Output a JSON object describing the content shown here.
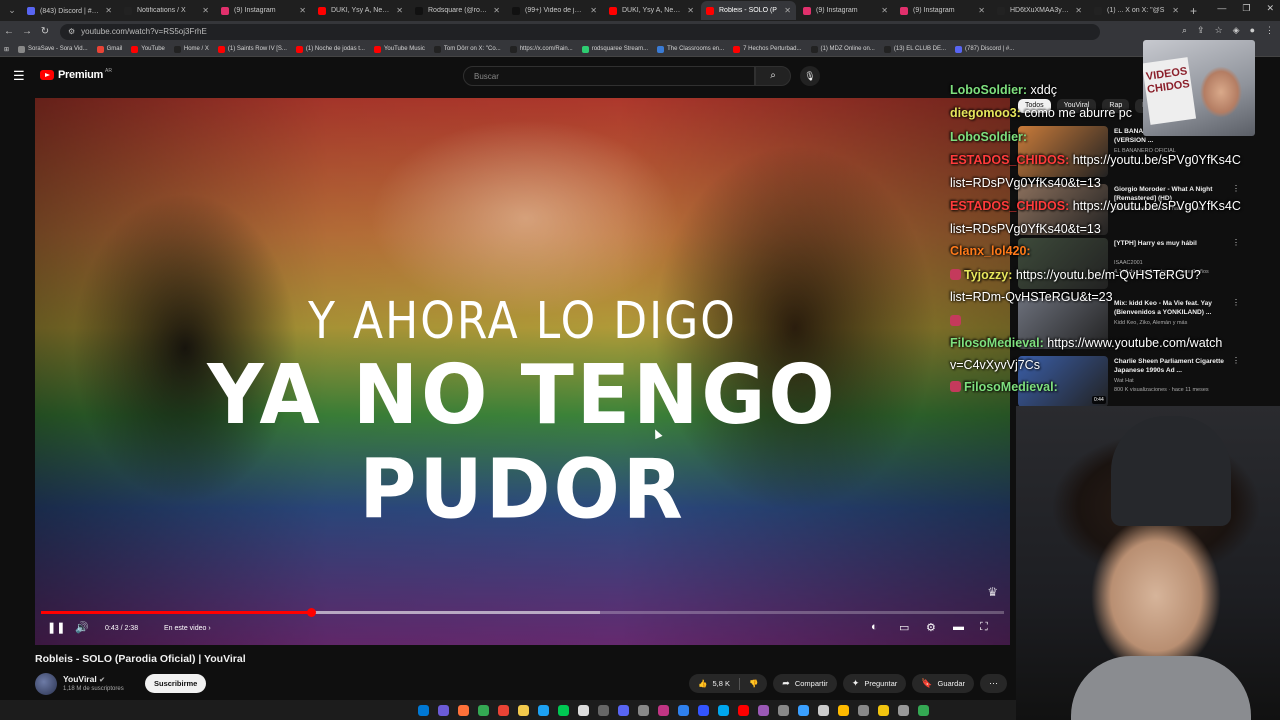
{
  "browser": {
    "tabs": [
      {
        "label": "(843) Discord | #🎯 ro",
        "color": "#5865f2"
      },
      {
        "label": "Notifications / X",
        "color": "#222222"
      },
      {
        "label": "(9) Instagram",
        "color": "#e1306c"
      },
      {
        "label": "DUKI, Ysy A, Neo Pist",
        "color": "#ff0000"
      },
      {
        "label": "Rodsquare (@rodsqu",
        "color": "#111111"
      },
      {
        "label": "(99+) Video de jonefe",
        "color": "#111111"
      },
      {
        "label": "DUKI, Ysy A, Neo Pist",
        "color": "#ff0000"
      },
      {
        "label": "Robleis - SOLO (P",
        "color": "#ff0000",
        "active": true
      },
      {
        "label": "(9) Instagram",
        "color": "#e1306c"
      },
      {
        "label": "(9) Instagram",
        "color": "#e1306c"
      },
      {
        "label": "HD6tXuXMAA3yqH",
        "color": "#222222"
      },
      {
        "label": "(1) ... X on X: \"@S",
        "color": "#222222"
      }
    ],
    "url": "youtube.com/watch?v=RS5oj3FrhE",
    "bookmarks": [
      {
        "label": "SoraSave - Sora Vid...",
        "color": "#888888"
      },
      {
        "label": "Gmail",
        "color": "#ea4335"
      },
      {
        "label": "YouTube",
        "color": "#ff0000"
      },
      {
        "label": "Home / X",
        "color": "#222222"
      },
      {
        "label": "(1) Saints Row IV [S...",
        "color": "#ff0000"
      },
      {
        "label": "(1) Noche de jodas t...",
        "color": "#ff0000"
      },
      {
        "label": "YouTube Music",
        "color": "#ff0000"
      },
      {
        "label": "Tom Dörr on X: \"Co...",
        "color": "#222222"
      },
      {
        "label": "https://x.com/Rain...",
        "color": "#222222"
      },
      {
        "label": "rodsquaree Stream...",
        "color": "#2ecc71"
      },
      {
        "label": "The Classrooms en...",
        "color": "#3a7bd5"
      },
      {
        "label": "7 Hechos Perturbad...",
        "color": "#ff0000"
      },
      {
        "label": "(1) MDZ Online on...",
        "color": "#222222"
      },
      {
        "label": "(13) EL CLUB DE...",
        "color": "#222222"
      },
      {
        "label": "(787) Discord | #...",
        "color": "#5865f2"
      }
    ]
  },
  "youtube": {
    "logo_text": "Premium",
    "country": "AR",
    "search_placeholder": "Buscar"
  },
  "player": {
    "lyric_line1": "Y AHORA LO DIGO",
    "lyric_line2": "YA NO TENGO PUDOR",
    "time": "0:43 / 2:38",
    "chapter": "En este video",
    "played_fraction": 0.28,
    "loaded_fraction": 0.58
  },
  "video": {
    "title": "Robleis - SOLO (Parodia Oficial) | YouViral",
    "channel": "YouViral",
    "subscribers": "1,18 M de suscriptores",
    "subscribe_label": "Suscribirme",
    "likes": "5,8 K",
    "share_label": "Compartir",
    "ask_label": "Preguntar",
    "save_label": "Guardar"
  },
  "filters": [
    "Todos",
    "YouViral",
    "Rap",
    "F"
  ],
  "recommendations": [
    {
      "title": "EL BANANERO - \"GANGNAM STYLE\" (VERSION ...",
      "channel": "EL BANANERO OFICIAL",
      "meta": "",
      "duration": "",
      "thumb": "#c97b3a"
    },
    {
      "title": "Giorgio Moroder - What A Night [Remastered] (HD)",
      "channel": "",
      "meta": "328 K visualizaciones · hace 12 años",
      "duration": "",
      "thumb": "#8a6f5c"
    },
    {
      "title": "[YTPH] Harry es muy hábil",
      "channel": "ISAAC2001",
      "meta": "4,1 M de visualizaciones · hace 7 años",
      "duration": "",
      "thumb": "#3d4a3a"
    },
    {
      "title": "Mix: kidd Keo - Ma Vie feat. Yay (Bienvenidos a YONKILAND) ...",
      "channel": "Kidd Keo, Ziko, Alemán y más",
      "meta": "",
      "duration": "",
      "thumb": "#6b6f7a"
    },
    {
      "title": "Charlie Sheen Parliament Cigarette Japanese 1990s Ad ...",
      "channel": "Wat Hat",
      "meta": "800 K visualizaciones · hace 11 meses",
      "duration": "0:44",
      "thumb": "#3a5ea8"
    }
  ],
  "chat": [
    {
      "user": "LoboSoldier:",
      "text": " xddç",
      "color": "#7ee07e",
      "badge": false
    },
    {
      "user": "diegomoo3:",
      "text": " como me aburre pc",
      "color": "#e6e65c",
      "badge": false
    },
    {
      "user": "LoboSoldier:",
      "text": "",
      "color": "#7ee07e",
      "badge": false
    },
    {
      "user": "ESTADOS_CHIDOS:",
      "text": " https://youtu.be/sPVg0YfKs4C",
      "color": "#ff3b3b",
      "badge": false
    },
    {
      "user": "",
      "text": "list=RDsPVg0YfKs40&t=13",
      "color": "#ffffff",
      "badge": false
    },
    {
      "user": "ESTADOS_CHIDOS:",
      "text": " https://youtu.be/sPVg0YfKs4C",
      "color": "#ff3b3b",
      "badge": false
    },
    {
      "user": "",
      "text": "list=RDsPVg0YfKs40&t=13",
      "color": "#ffffff",
      "badge": false
    },
    {
      "user": "Clanx_lol420:",
      "text": "",
      "color": "#ff7a1a",
      "badge": false
    },
    {
      "user": "Tyjozzy:",
      "text": " https://youtu.be/m-QvHSTeRGU?",
      "color": "#e6e65c",
      "badge": true
    },
    {
      "user": "",
      "text": "list=RDm-QvHSTeRGU&t=23",
      "color": "#ffffff",
      "badge": false
    },
    {
      "user": "",
      "text": "",
      "color": "#ffffff",
      "badge": true
    },
    {
      "user": "FilosoMedieval:",
      "text": " https://www.youtube.com/watch",
      "color": "#7ee07e",
      "badge": false
    },
    {
      "user": "",
      "text": "v=C4vXyvVj7Cs",
      "color": "#ffffff",
      "badge": false
    },
    {
      "user": "FilosoMedieval:",
      "text": "",
      "color": "#7ee07e",
      "badge": true
    }
  ],
  "pip_sign": "VIDEOS CHIDOS",
  "taskbar_colors": [
    "#0078d4",
    "#6b5bd6",
    "#ff7139",
    "#34a853",
    "#ea4335",
    "#f2c94c",
    "#1da1f2",
    "#00c853",
    "#dddddd",
    "#666666",
    "#5865f2",
    "#888888",
    "#c13584",
    "#2f80ed",
    "#3355ff",
    "#00a6ed",
    "#ff0000",
    "#9b59b6",
    "#888888",
    "#3aa0ff",
    "#cccccc",
    "#ffbb00",
    "#888888",
    "#f1c40f",
    "#999999",
    "#34a853"
  ]
}
